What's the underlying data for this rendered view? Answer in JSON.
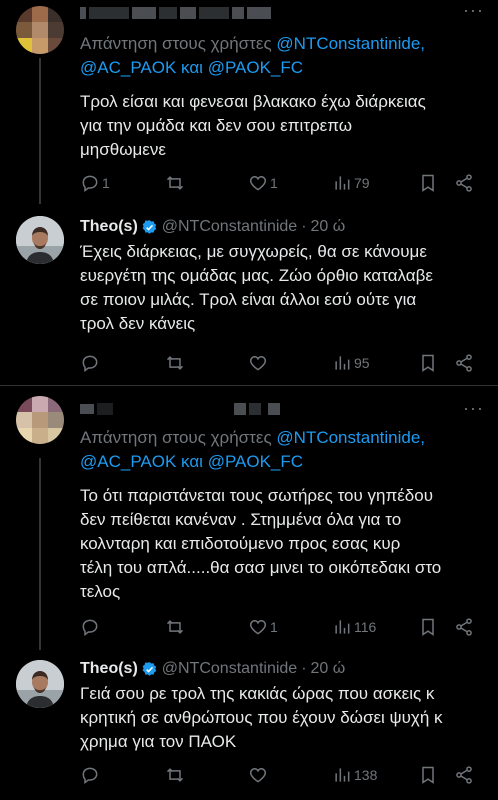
{
  "tweets": [
    {
      "replying_prefix": "Απάντηση στους χρήστες",
      "mention1": "@NTConstantinide,",
      "mention2": "@AC_PAOK",
      "conj": "και",
      "mention3": "@PAOK_FC",
      "lines": [
        "Τρολ είσαι και φενεσαι βλακακο έχω διάρκειας",
        "για την ομάδα και δεν  σου επιτρεπω",
        "μησθωμενε"
      ],
      "replies": "1",
      "retweets": "",
      "likes": "1",
      "views": "79",
      "more": "···"
    },
    {
      "name": "Theo(s)",
      "handle": "@NTConstantinide",
      "dot": "·",
      "time": "20 ώ",
      "lines": [
        "Έχεις διάρκειας, με συγχωρείς, θα σε κάνουμε",
        "ευεργέτη της ομάδας μας. Ζώο όρθιο καταλαβε",
        "σε ποιον μιλάς. Τρολ είναι άλλοι εσύ ούτε για",
        "τρολ δεν κάνεις"
      ],
      "replies": "",
      "retweets": "",
      "likes": "",
      "views": "95"
    },
    {
      "replying_prefix": "Απάντηση στους χρήστες",
      "mention1": "@NTConstantinide,",
      "mention2": "@AC_PAOK",
      "conj": "και",
      "mention3": "@PAOK_FC",
      "lines": [
        "Το ότι παριστάνεται τους σωτήρες του γηπέδου",
        "δεν πείθεται  κανέναν . Στημμένα όλα για το",
        "κολνταρη και επιδοτούμενο προς εσας  κυρ",
        "τέλη του απλά.....θα σασ μινει το οικόπεδακι στο",
        "τελος"
      ],
      "replies": "",
      "retweets": "",
      "likes": "1",
      "views": "116",
      "more": "···"
    },
    {
      "name": "Theo(s)",
      "handle": "@NTConstantinide",
      "dot": "·",
      "time": "20 ώ",
      "lines": [
        "Γειά σου ρε τρολ της κακιάς ώρας που ασκεις κ",
        "κρητική σε ανθρώπους που έχουν δώσει ψυχή κ",
        "χρημα για τον ΠΑΟΚ"
      ],
      "replies": "",
      "retweets": "",
      "likes": "",
      "views": "138"
    }
  ],
  "colors": {
    "background": "#000000",
    "text": "#e7e9ea",
    "muted": "#71767b",
    "accent": "#1d9bf0",
    "divider": "#2f3336"
  },
  "icons": [
    "reply-icon",
    "retweet-icon",
    "like-icon",
    "views-icon",
    "bookmark-icon",
    "share-icon",
    "verified-badge-icon",
    "more-icon"
  ]
}
